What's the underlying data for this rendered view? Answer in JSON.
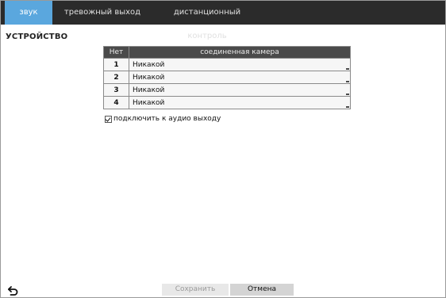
{
  "tabs": [
    {
      "label": "звук",
      "active": true
    },
    {
      "label": "тревожный выход",
      "active": false
    },
    {
      "label": "дистанционный контроль",
      "active": false
    }
  ],
  "section_title": "УСТРОЙСТВО",
  "table": {
    "headers": [
      "Нет",
      "соединенная камера"
    ],
    "rows": [
      {
        "num": "1",
        "camera": "Никакой"
      },
      {
        "num": "2",
        "camera": "Никакой"
      },
      {
        "num": "3",
        "camera": "Никакой"
      },
      {
        "num": "4",
        "camera": "Никакой"
      }
    ]
  },
  "checkbox": {
    "label": "подключить к аудио выходу",
    "checked": true
  },
  "buttons": {
    "save": "Сохранить",
    "cancel": "Отмена",
    "back_icon": "back-arrow-icon"
  },
  "colors": {
    "tab_active": "#5aa7de",
    "tab_bar": "#2b2b2b",
    "table_header": "#4a4a4a"
  }
}
